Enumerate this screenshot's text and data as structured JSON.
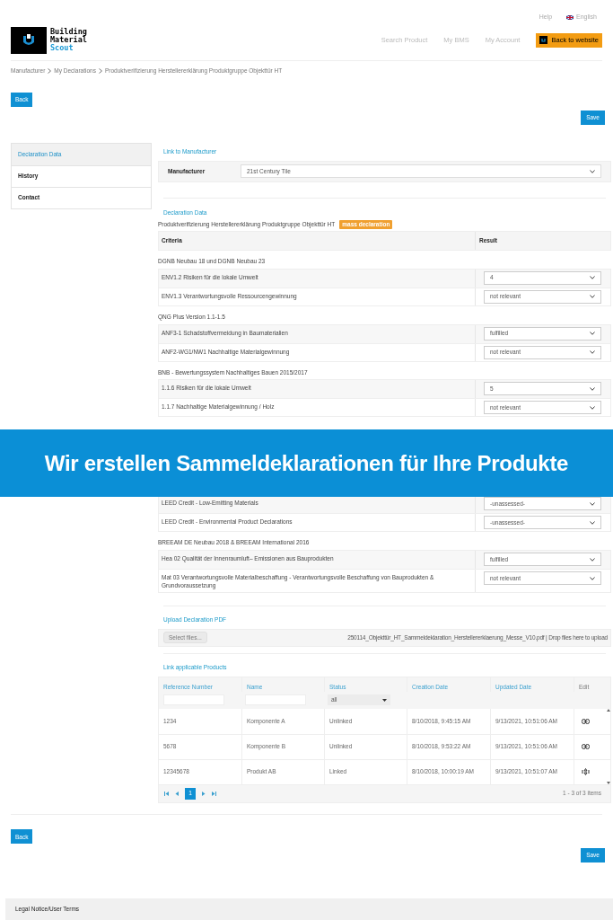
{
  "top_links": {
    "help": "Help",
    "language": "English"
  },
  "logo": {
    "lines": [
      "Building",
      "Material",
      "Scout"
    ]
  },
  "nav": [
    "Search Product",
    "My BMS",
    "My Account"
  ],
  "back_to_website": "Back to website",
  "breadcrumb": [
    "Manufacturer",
    "My Declarations",
    "Produktverifizierung Herstellererklärung Produktgruppe Objekttür HT"
  ],
  "buttons": {
    "back_top": "Back",
    "save_top": "Save",
    "back_bottom": "Back",
    "save_bottom": "Save"
  },
  "sidebar": {
    "items": [
      {
        "label": "Declaration Data",
        "selected": true
      },
      {
        "label": "History",
        "selected": false
      },
      {
        "label": "Contact",
        "selected": false
      }
    ]
  },
  "manufacturer_section": {
    "title": "Link to Manufacturer",
    "label": "Manufacturer",
    "value": "21st Century Tile"
  },
  "declaration": {
    "title": "Declaration Data",
    "name": "Produktverifizierung Herstellererklärung Produktgruppe Objekttür HT",
    "badge": "mass declaration",
    "columns": [
      "Criteria",
      "Result"
    ],
    "groups": [
      {
        "title": "DGNB Neubau 18 und DGNB Neubau 23",
        "rows": [
          {
            "criterion": "ENV1.2 Risiken für die lokale Umwelt",
            "result": "4"
          },
          {
            "criterion": "ENV1.3 Verantwortungsvolle Ressourcengewinnung",
            "result": "not relevant"
          }
        ]
      },
      {
        "title": "QNG Plus Version 1.1-1.5",
        "rows": [
          {
            "criterion": "ANF3-1 Schadstoffvermeidung in Baumaterialien",
            "result": "fulfilled"
          },
          {
            "criterion": "ANF2-WG1/NW1 Nachhaltige Materialgewinnung",
            "result": "not relevant"
          }
        ]
      },
      {
        "title": "BNB - Bewertungssystem Nachhaltiges Bauen 2015/2017",
        "rows": [
          {
            "criterion": "1.1.6 Risiken für die lokale Umwelt",
            "result": "5"
          },
          {
            "criterion": "1.1.7 Nachhaltige Materialgewinnung / Holz",
            "result": "not relevant"
          }
        ]
      },
      {
        "rows": [
          {
            "criterion": "LEED Credit - Low-Emitting Materials",
            "result": "-unassessed-"
          },
          {
            "criterion": "LEED Credit - Environmental Product Declarations",
            "result": "-unassessed-"
          }
        ]
      },
      {
        "title": "BREEAM DE Neubau 2018 & BREEAM International 2016",
        "rows": [
          {
            "criterion": "Hea 02 Qualität der Innenraumluft– Emissionen aus Bauprodukten",
            "result": "fulfilled"
          },
          {
            "criterion": "Mat 03 Verantwortungsvolle Materialbeschaffung - Verantwortungsvolle Beschaffung von Bauprodukten & Grundvoraussetzung",
            "result": "not relevant"
          }
        ]
      }
    ]
  },
  "banner": "Wir erstellen Sammeldeklarationen für Ihre Produkte",
  "upload": {
    "title": "Upload Declaration PDF",
    "button": "Select files...",
    "file": "250114_Objekttür_HT_Sammeldeklaration_Herstellererklaerung_Messe_V10.pdf | Drop files here to upload"
  },
  "products": {
    "title": "Link applicable Products",
    "columns": [
      "Reference Number",
      "Name",
      "Status",
      "Creation Date",
      "Updated Date",
      "Edit"
    ],
    "status_filter": "all",
    "rows": [
      {
        "reference": "1234",
        "name": "Komponente A",
        "status": "Unlinked",
        "created": "8/10/2018, 9:45:15 AM",
        "updated": "9/13/2021, 10:51:06 AM",
        "linked": false
      },
      {
        "reference": "5678",
        "name": "Komponente B",
        "status": "Unlinked",
        "created": "8/10/2018, 9:53:22 AM",
        "updated": "9/13/2021, 10:51:06 AM",
        "linked": false
      },
      {
        "reference": "12345678",
        "name": "Produkt AB",
        "status": "Linked",
        "created": "8/10/2018, 10:00:19 AM",
        "updated": "9/13/2021, 10:51:07 AM",
        "linked": true
      }
    ],
    "pages": [
      {
        "label": "1",
        "selected": true
      }
    ],
    "summary": "1 - 3 of 3 items"
  },
  "footer": "Legal Notice/User Terms"
}
